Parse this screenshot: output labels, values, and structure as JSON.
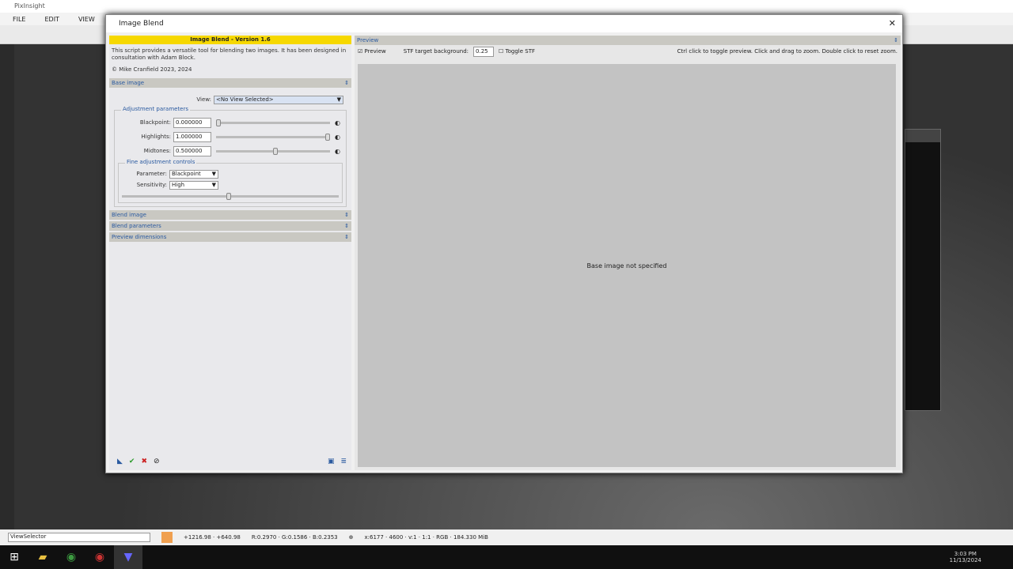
{
  "app": {
    "title": "PixInsight",
    "menu": [
      "FILE",
      "EDIT",
      "VIEW"
    ]
  },
  "dialog": {
    "title": "Image Blend",
    "banner": "Image Blend - Version 1.6",
    "description": "This script provides a versatile tool for blending two images. It has been designed in consultation with Adam Block.",
    "copyright": "© Mike Cranfield 2023, 2024",
    "base_section": "Base image",
    "view_label": "View:",
    "view_value": "<No View Selected>",
    "adjust_title": "Adjustment parameters",
    "params": [
      {
        "label": "Blackpoint:",
        "value": "0.000000",
        "pos": 0
      },
      {
        "label": "Highlights:",
        "value": "1.000000",
        "pos": 1
      },
      {
        "label": "Midtones:",
        "value": "0.500000",
        "pos": 0.5
      }
    ],
    "fine_title": "Fine adjustment controls",
    "parameter_label": "Parameter:",
    "parameter_value": "Blackpoint",
    "sensitivity_label": "Sensitivity:",
    "sensitivity_value": "High",
    "sections": [
      "Blend image",
      "Blend parameters",
      "Preview dimensions"
    ],
    "preview_section": "Preview",
    "preview_check": "Preview",
    "stf_label": "STF target background:",
    "stf_value": "0.25",
    "toggle_stf": "Toggle STF",
    "hint": "Ctrl click to toggle preview. Click and drag to zoom. Double click to reset zoom.",
    "canvas_msg": "Base image not specified"
  },
  "status": {
    "view": "ViewSelector",
    "coords": "+1216.98 · +640.98",
    "vals": "R:0.2970 · G:0.1586 · B:0.2353",
    "info": "x:6177 · 4600 · v:1 · 1:1 · RGB · 184.330 MiB"
  },
  "taskbar": {
    "time": "3:03 PM",
    "date": "11/13/2024"
  }
}
